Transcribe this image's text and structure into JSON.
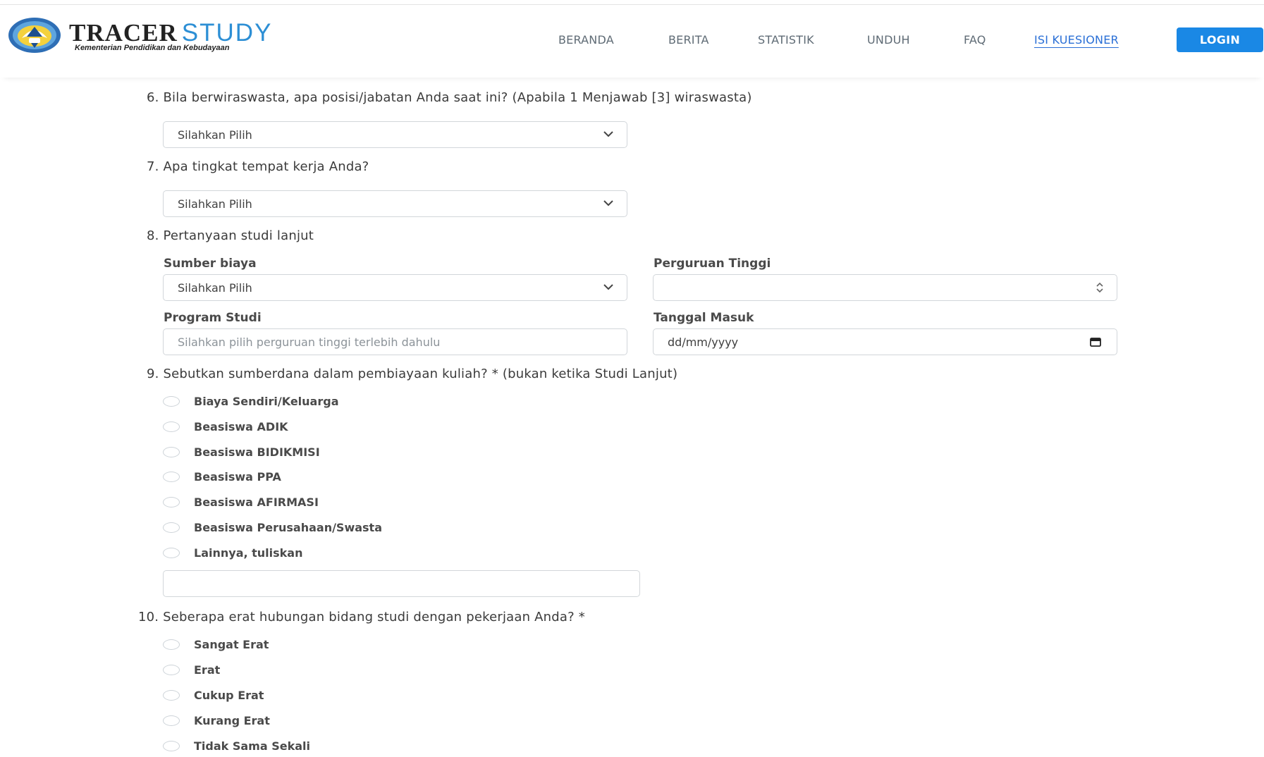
{
  "header": {
    "brand_primary": "TRACER",
    "brand_secondary": "STUDY",
    "brand_subtitle": "Kementerian Pendidikan dan Kebudayaan",
    "nav": [
      "BERANDA",
      "BERITA",
      "STATISTIK",
      "UNDUH",
      "FAQ",
      "ISI KUESIONER"
    ],
    "active_nav": "ISI KUESIONER",
    "login_label": "LOGIN",
    "accent_color": "#1a88e5"
  },
  "form": {
    "q6": {
      "text": "6. Bila berwiraswasta, apa posisi/jabatan Anda saat ini? (Apabila 1 Menjawab [3] wiraswasta)",
      "select_value": "Silahkan Pilih"
    },
    "q7": {
      "text": "7. Apa tingkat tempat kerja Anda?",
      "select_value": "Silahkan Pilih"
    },
    "q8": {
      "text": "8. Pertanyaan studi lanjut",
      "sumber_biaya_label": "Sumber biaya",
      "sumber_biaya_value": "Silahkan Pilih",
      "perguruan_tinggi_label": "Perguruan Tinggi",
      "perguruan_tinggi_value": "",
      "program_studi_label": "Program Studi",
      "program_studi_placeholder": "Silahkan pilih perguruan tinggi terlebih dahulu",
      "tanggal_masuk_label": "Tanggal Masuk",
      "tanggal_masuk_value": "dd/mm/yyyy"
    },
    "q9": {
      "text": "9. Sebutkan sumberdana dalam pembiayaan kuliah? * (bukan ketika Studi Lanjut)",
      "options": [
        "Biaya Sendiri/Keluarga",
        "Beasiswa ADIK",
        "Beasiswa BIDIKMISI",
        "Beasiswa PPA",
        "Beasiswa AFIRMASI",
        "Beasiswa Perusahaan/Swasta",
        "Lainnya, tuliskan"
      ],
      "other_value": ""
    },
    "q10": {
      "text": "10. Seberapa erat hubungan bidang studi dengan pekerjaan Anda? *",
      "options": [
        "Sangat Erat",
        "Erat",
        "Cukup Erat",
        "Kurang Erat",
        "Tidak Sama Sekali"
      ]
    }
  }
}
